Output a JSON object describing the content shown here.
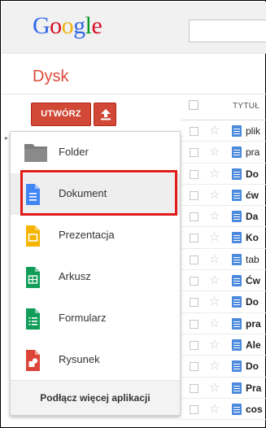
{
  "header": {
    "logo_letters": [
      "G",
      "o",
      "o",
      "g",
      "l",
      "e"
    ],
    "logo_colors": [
      "#3369e8",
      "#d50f25",
      "#eeb211",
      "#3369e8",
      "#009925",
      "#d50f25"
    ]
  },
  "app": {
    "title": "Dysk",
    "accent": "#dd4b39"
  },
  "toolbar": {
    "create_label": "UTWÓRZ",
    "upload_icon": "upload-arrow-icon"
  },
  "file_list": {
    "column_title": "TYTUŁ",
    "rows": [
      {
        "name": "plik",
        "bold": false
      },
      {
        "name": "pra",
        "bold": false
      },
      {
        "name": "Do",
        "bold": true
      },
      {
        "name": "ćw",
        "bold": true
      },
      {
        "name": "Da",
        "bold": true
      },
      {
        "name": "Ko",
        "bold": true
      },
      {
        "name": "tab",
        "bold": false
      },
      {
        "name": "Ćw",
        "bold": true
      },
      {
        "name": "Do",
        "bold": true
      },
      {
        "name": "pra",
        "bold": true
      },
      {
        "name": "Ale",
        "bold": true
      },
      {
        "name": "Do",
        "bold": true
      },
      {
        "name": "Pra",
        "bold": true
      },
      {
        "name": "cos",
        "bold": true
      }
    ]
  },
  "create_menu": {
    "items": [
      {
        "label": "Folder",
        "icon": "folder-icon",
        "color": "#777777"
      },
      {
        "label": "Dokument",
        "icon": "document-icon",
        "color": "#4285f4"
      },
      {
        "label": "Prezentacja",
        "icon": "presentation-icon",
        "color": "#f4b400"
      },
      {
        "label": "Arkusz",
        "icon": "spreadsheet-icon",
        "color": "#0f9d58"
      },
      {
        "label": "Formularz",
        "icon": "form-icon",
        "color": "#0f9d58"
      },
      {
        "label": "Rysunek",
        "icon": "drawing-icon",
        "color": "#db4437"
      }
    ],
    "connect_label": "Podłącz więcej aplikacji",
    "highlighted_item": "Dokument",
    "highlight_color": "#e11a1a"
  }
}
